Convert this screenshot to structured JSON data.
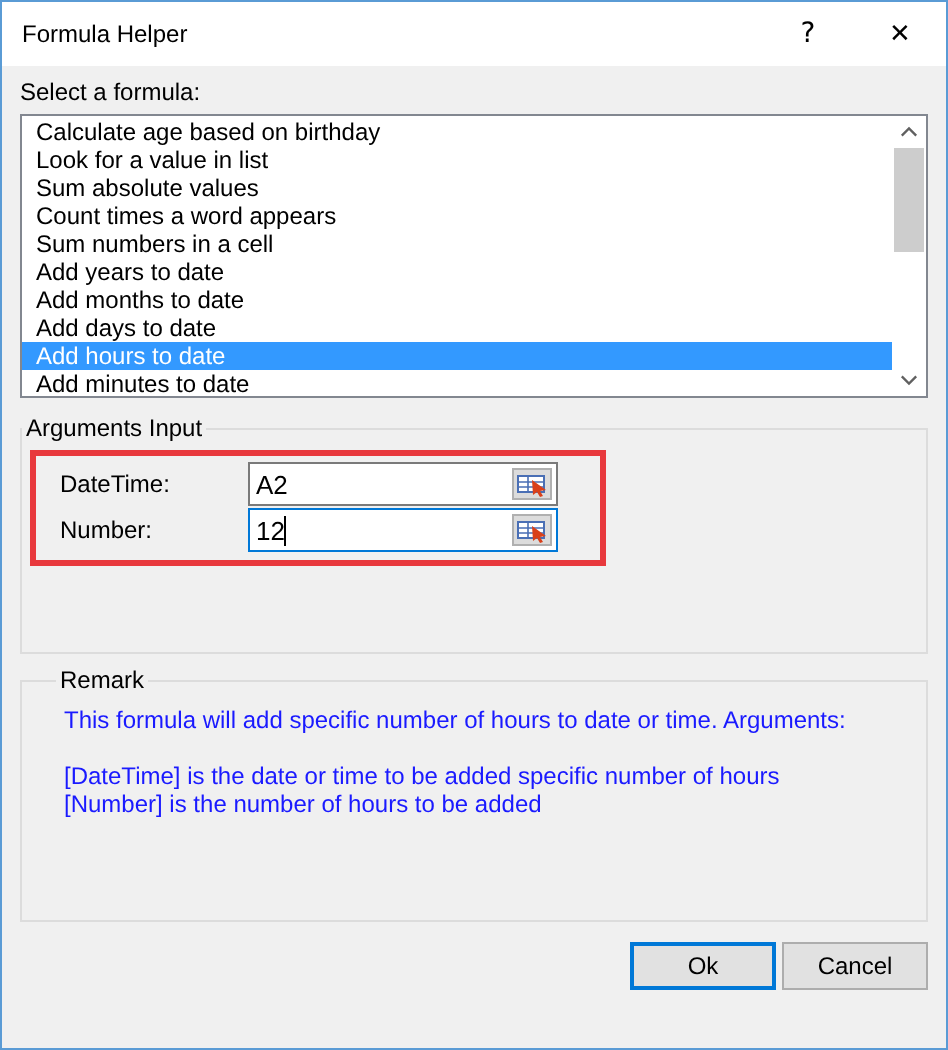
{
  "window": {
    "title": "Formula Helper",
    "help": "?",
    "close": "✕"
  },
  "formula_list": {
    "label": "Select a formula:",
    "items": [
      {
        "label": "Calculate age based on birthday",
        "selected": false
      },
      {
        "label": "Look for a value in list",
        "selected": false
      },
      {
        "label": "Sum absolute values",
        "selected": false
      },
      {
        "label": "Count times a word appears",
        "selected": false
      },
      {
        "label": "Sum numbers in a cell",
        "selected": false
      },
      {
        "label": "Add years to date",
        "selected": false
      },
      {
        "label": "Add months to date",
        "selected": false
      },
      {
        "label": "Add days to date",
        "selected": false
      },
      {
        "label": "Add hours to date",
        "selected": true
      },
      {
        "label": "Add minutes to date",
        "selected": false
      }
    ]
  },
  "arguments": {
    "title": "Arguments Input",
    "highlighted": true,
    "fields": [
      {
        "label": "DateTime:",
        "value": "A2",
        "focused": false
      },
      {
        "label": "Number:",
        "value": "12",
        "focused": true
      }
    ]
  },
  "remark": {
    "title": "Remark",
    "lines": [
      "This formula will add specific number of hours to date or time. Arguments:",
      "[DateTime] is the date or time to be added specific number of hours",
      "[Number] is the number of hours to be added"
    ]
  },
  "buttons": [
    {
      "label": "Ok",
      "default": true
    },
    {
      "label": "Cancel",
      "default": false
    }
  ]
}
